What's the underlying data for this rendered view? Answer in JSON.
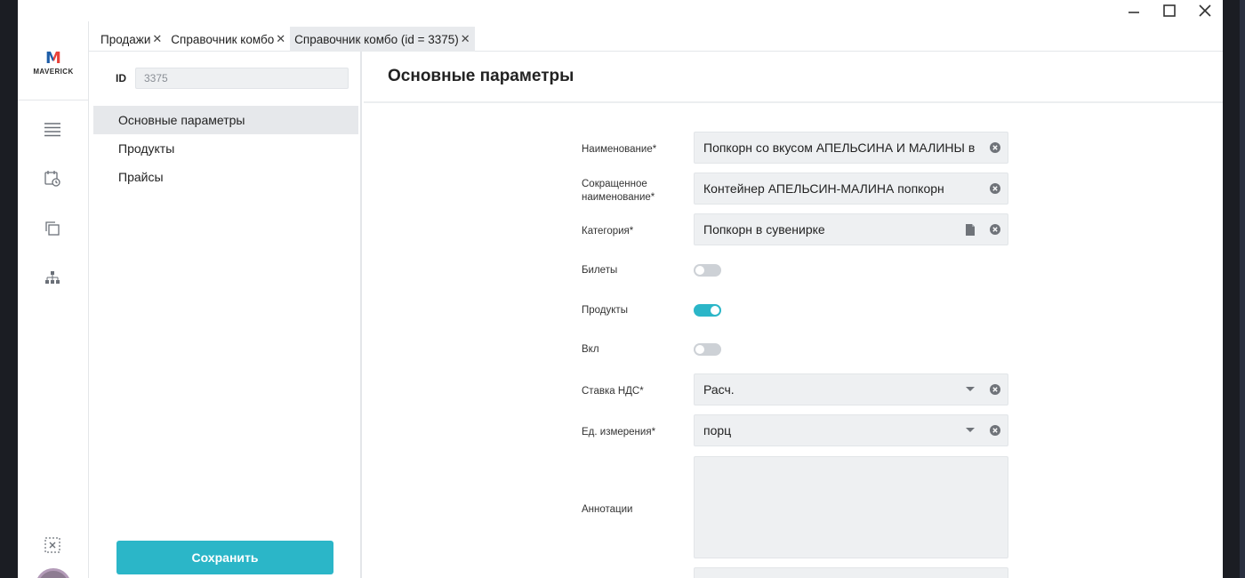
{
  "app": {
    "logo_letter": "M",
    "logo_word": "MAVERICK"
  },
  "tabs": [
    {
      "label": "Продажи",
      "close": "✕"
    },
    {
      "label": "Справочник комбо",
      "close": "✕"
    },
    {
      "label": "Справочник комбо (id = 3375)",
      "close": "✕"
    }
  ],
  "sidebar": {
    "id_label": "ID",
    "id_value": "3375",
    "items": [
      {
        "label": "Основные параметры"
      },
      {
        "label": "Продукты"
      },
      {
        "label": "Прайсы"
      }
    ],
    "save_label": "Сохранить"
  },
  "main": {
    "title": "Основные параметры",
    "fields": {
      "name": {
        "label": "Наименование*",
        "value": "Попкорн со вкусом АПЕЛЬСИНА И МАЛИНЫ в"
      },
      "short_name": {
        "label_line1": "Сокращенное",
        "label_line2": "наименование*",
        "value": "Контейнер АПЕЛЬСИН-МАЛИНА попкорн"
      },
      "category": {
        "label": "Категория*",
        "value": "Попкорн в сувенирке"
      },
      "tickets": {
        "label": "Билеты",
        "on": false
      },
      "products": {
        "label": "Продукты",
        "on": true
      },
      "enabled": {
        "label": "Вкл",
        "on": false
      },
      "vat": {
        "label": "Ставка НДС*",
        "value": "Расч."
      },
      "unit": {
        "label": "Ед. измерения*",
        "value": "порц"
      },
      "annotations": {
        "label": "Аннотации",
        "value": ""
      }
    }
  },
  "colors": {
    "accent": "#2bb6c8",
    "field_bg": "#eef0f2",
    "logo_blue": "#1e5ea8",
    "logo_red": "#e8423a"
  },
  "icons": [
    "minimize-icon",
    "maximize-icon",
    "close-icon",
    "menu-icon",
    "calendar-clock-icon",
    "copy-icon",
    "hierarchy-icon",
    "collapse-icon",
    "clear-icon",
    "document-icon",
    "dropdown-arrow-icon"
  ]
}
